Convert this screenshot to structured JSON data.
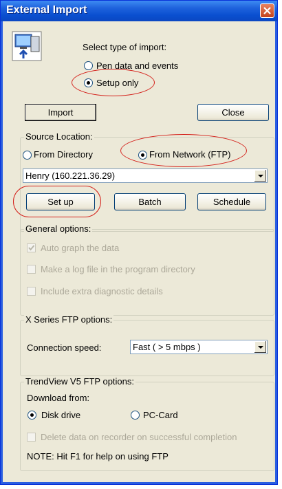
{
  "window": {
    "title": "External Import"
  },
  "import_type": {
    "prompt": "Select type of import:",
    "options": [
      {
        "label": "Pen data and events",
        "selected": false
      },
      {
        "label": "Setup only",
        "selected": true
      }
    ]
  },
  "top_buttons": {
    "import": "Import",
    "close": "Close"
  },
  "source": {
    "legend": "Source Location:",
    "from_directory": "From Directory",
    "from_network": "From Network (FTP)",
    "selected": "From Network (FTP)",
    "server_value": "Henry (160.221.36.29)",
    "buttons": {
      "setup": "Set up",
      "batch": "Batch",
      "schedule": "Schedule"
    }
  },
  "general": {
    "legend": "General options:",
    "options": [
      {
        "label": "Auto graph the data",
        "checked": true
      },
      {
        "label": "Make a log file in the program directory",
        "checked": false
      },
      {
        "label": "Include extra diagnostic details",
        "checked": false
      }
    ]
  },
  "xseries": {
    "legend": "X Series FTP options:",
    "speed_label": "Connection speed:",
    "speed_value": "Fast ( > 5 mbps )"
  },
  "trendview": {
    "legend": "TrendView V5 FTP options:",
    "download_label": "Download from:",
    "disk_drive": "Disk drive",
    "pc_card": "PC-Card",
    "download_selected": "Disk drive",
    "delete_label": "Delete data on recorder on successful completion",
    "note": "NOTE: Hit F1 for help on using FTP"
  },
  "icons": [
    "computer-import-icon",
    "close-icon",
    "chevron-down-icon",
    "check-icon"
  ],
  "colors": {
    "titlebar": "#0a4fd0",
    "highlight_ring": "#d4201a",
    "dialog_bg": "#ece9d8"
  }
}
